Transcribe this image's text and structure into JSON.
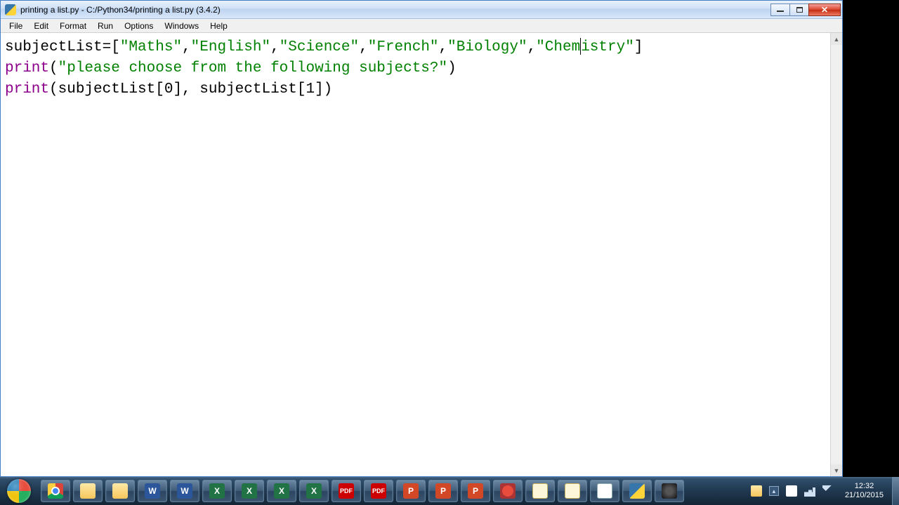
{
  "window": {
    "title": "printing a list.py - C:/Python34/printing a list.py (3.4.2)"
  },
  "menus": [
    "File",
    "Edit",
    "Format",
    "Run",
    "Options",
    "Windows",
    "Help"
  ],
  "code": {
    "l1": {
      "a": "subjectList=[",
      "s0": "\"Maths\"",
      "c0": ",",
      "s1": "\"English\"",
      "c1": ",",
      "s2": "\"Science\"",
      "c2": ",",
      "s3": "\"French\"",
      "c3": ",",
      "s4": "\"Biology\"",
      "c4": ",",
      "s5a": "\"Chem",
      "s5b": "istry\"",
      "z": "]"
    },
    "l2": {
      "p": "print",
      "a": "(",
      "s": "\"please choose from the following subjects?\"",
      "z": ")"
    },
    "l3": {
      "p": "print",
      "body": "(subjectList[0], subjectList[1])"
    }
  },
  "taskbar": {
    "apps": [
      {
        "name": "chrome",
        "cls": "ic-chrome",
        "txt": ""
      },
      {
        "name": "explorer",
        "cls": "ic-folder",
        "txt": ""
      },
      {
        "name": "explorer-2",
        "cls": "ic-folder",
        "txt": ""
      },
      {
        "name": "word",
        "cls": "ic-word",
        "txt": "W"
      },
      {
        "name": "word-2",
        "cls": "ic-word",
        "txt": "W"
      },
      {
        "name": "excel",
        "cls": "ic-excel",
        "txt": "X"
      },
      {
        "name": "excel-2",
        "cls": "ic-excel",
        "txt": "X"
      },
      {
        "name": "excel-3",
        "cls": "ic-excel",
        "txt": "X"
      },
      {
        "name": "excel-4",
        "cls": "ic-excel",
        "txt": "X"
      },
      {
        "name": "pdf",
        "cls": "ic-pdf",
        "txt": "PDF"
      },
      {
        "name": "pdf-2",
        "cls": "ic-pdf",
        "txt": "PDF"
      },
      {
        "name": "ppt",
        "cls": "ic-ppt",
        "txt": "P"
      },
      {
        "name": "ppt-2",
        "cls": "ic-ppt",
        "txt": "P"
      },
      {
        "name": "ppt-3",
        "cls": "ic-ppt",
        "txt": "P"
      },
      {
        "name": "snagit",
        "cls": "ic-snag",
        "txt": ""
      },
      {
        "name": "notepad",
        "cls": "ic-note",
        "txt": ""
      },
      {
        "name": "notepad-2",
        "cls": "ic-note",
        "txt": ""
      },
      {
        "name": "idle",
        "cls": "ic-idle",
        "txt": ""
      },
      {
        "name": "python",
        "cls": "ic-py",
        "txt": ""
      },
      {
        "name": "obs",
        "cls": "ic-obs",
        "txt": ""
      }
    ],
    "clock": {
      "time": "12:32",
      "date": "21/10/2015"
    },
    "tray_expand": "▴"
  }
}
